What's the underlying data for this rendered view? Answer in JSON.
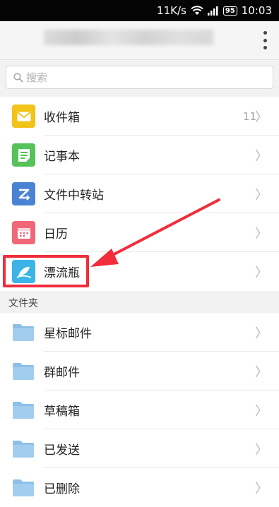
{
  "status_bar": {
    "speed": "11K/s",
    "battery": "95",
    "time": "10:03"
  },
  "header": {
    "account": "",
    "menu_icon": "overflow-menu-icon"
  },
  "search": {
    "placeholder": "搜索",
    "icon": "search-icon"
  },
  "main_items": [
    {
      "label": "收件箱",
      "count": "11",
      "icon": "inbox-icon",
      "color": "#f2c318"
    },
    {
      "label": "记事本",
      "count": "",
      "icon": "notepad-icon",
      "color": "#55c25a"
    },
    {
      "label": "文件中转站",
      "count": "",
      "icon": "file-transfer-icon",
      "color": "#4a82d4"
    },
    {
      "label": "日历",
      "count": "",
      "icon": "calendar-icon",
      "color": "#f0677a"
    },
    {
      "label": "漂流瓶",
      "count": "",
      "icon": "drift-bottle-icon",
      "color": "#3cb4e8"
    }
  ],
  "folders_section": {
    "title": "文件夹",
    "items": [
      {
        "label": "星标邮件",
        "icon": "folder-icon"
      },
      {
        "label": "群邮件",
        "icon": "folder-icon"
      },
      {
        "label": "草稿箱",
        "icon": "folder-icon"
      },
      {
        "label": "已发送",
        "icon": "folder-icon"
      },
      {
        "label": "已删除",
        "icon": "folder-icon"
      }
    ]
  },
  "colors": {
    "annotation": "#f12d3c",
    "folder": "#8ebfe6"
  }
}
